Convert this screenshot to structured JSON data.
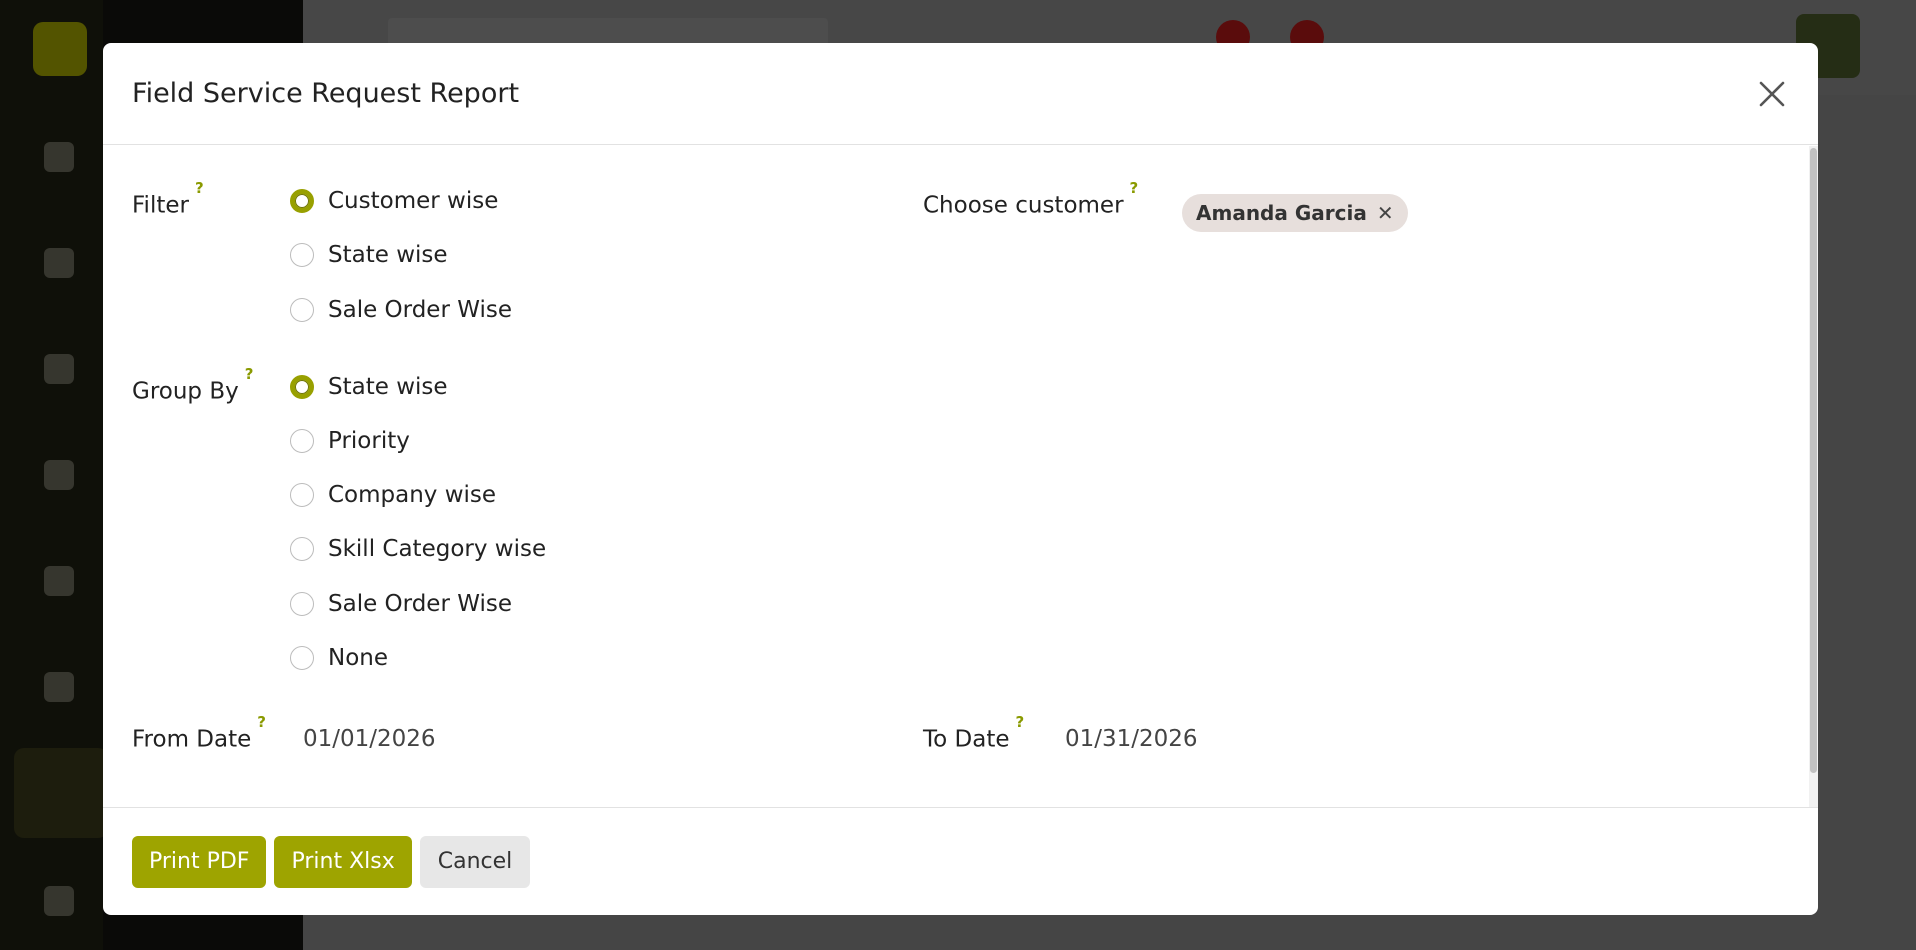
{
  "modal": {
    "title": "Field Service Request Report"
  },
  "filter": {
    "label": "Filter",
    "help": "?",
    "options": [
      {
        "label": "Customer wise",
        "checked": true
      },
      {
        "label": "State wise",
        "checked": false
      },
      {
        "label": "Sale Order Wise",
        "checked": false
      }
    ]
  },
  "customer": {
    "label": "Choose customer",
    "help": "?",
    "selected_tag": "Amanda Garcia",
    "remove_glyph": "✕"
  },
  "group_by": {
    "label": "Group By",
    "help": "?",
    "options": [
      {
        "label": "State wise",
        "checked": true
      },
      {
        "label": "Priority",
        "checked": false
      },
      {
        "label": "Company wise",
        "checked": false
      },
      {
        "label": "Skill Category wise",
        "checked": false
      },
      {
        "label": "Sale Order Wise",
        "checked": false
      },
      {
        "label": "None",
        "checked": false
      }
    ]
  },
  "dates": {
    "from_label": "From Date",
    "from_help": "?",
    "from_value": "01/01/2026",
    "to_label": "To Date",
    "to_help": "?",
    "to_value": "01/31/2026"
  },
  "footer": {
    "print_pdf": "Print PDF",
    "print_xlsx": "Print Xlsx",
    "cancel": "Cancel"
  },
  "colors": {
    "accent": "#9ea400",
    "help_mark": "#8a9a00",
    "tag_bg": "#e7dfdc"
  },
  "icons": {
    "close": "close-icon"
  }
}
